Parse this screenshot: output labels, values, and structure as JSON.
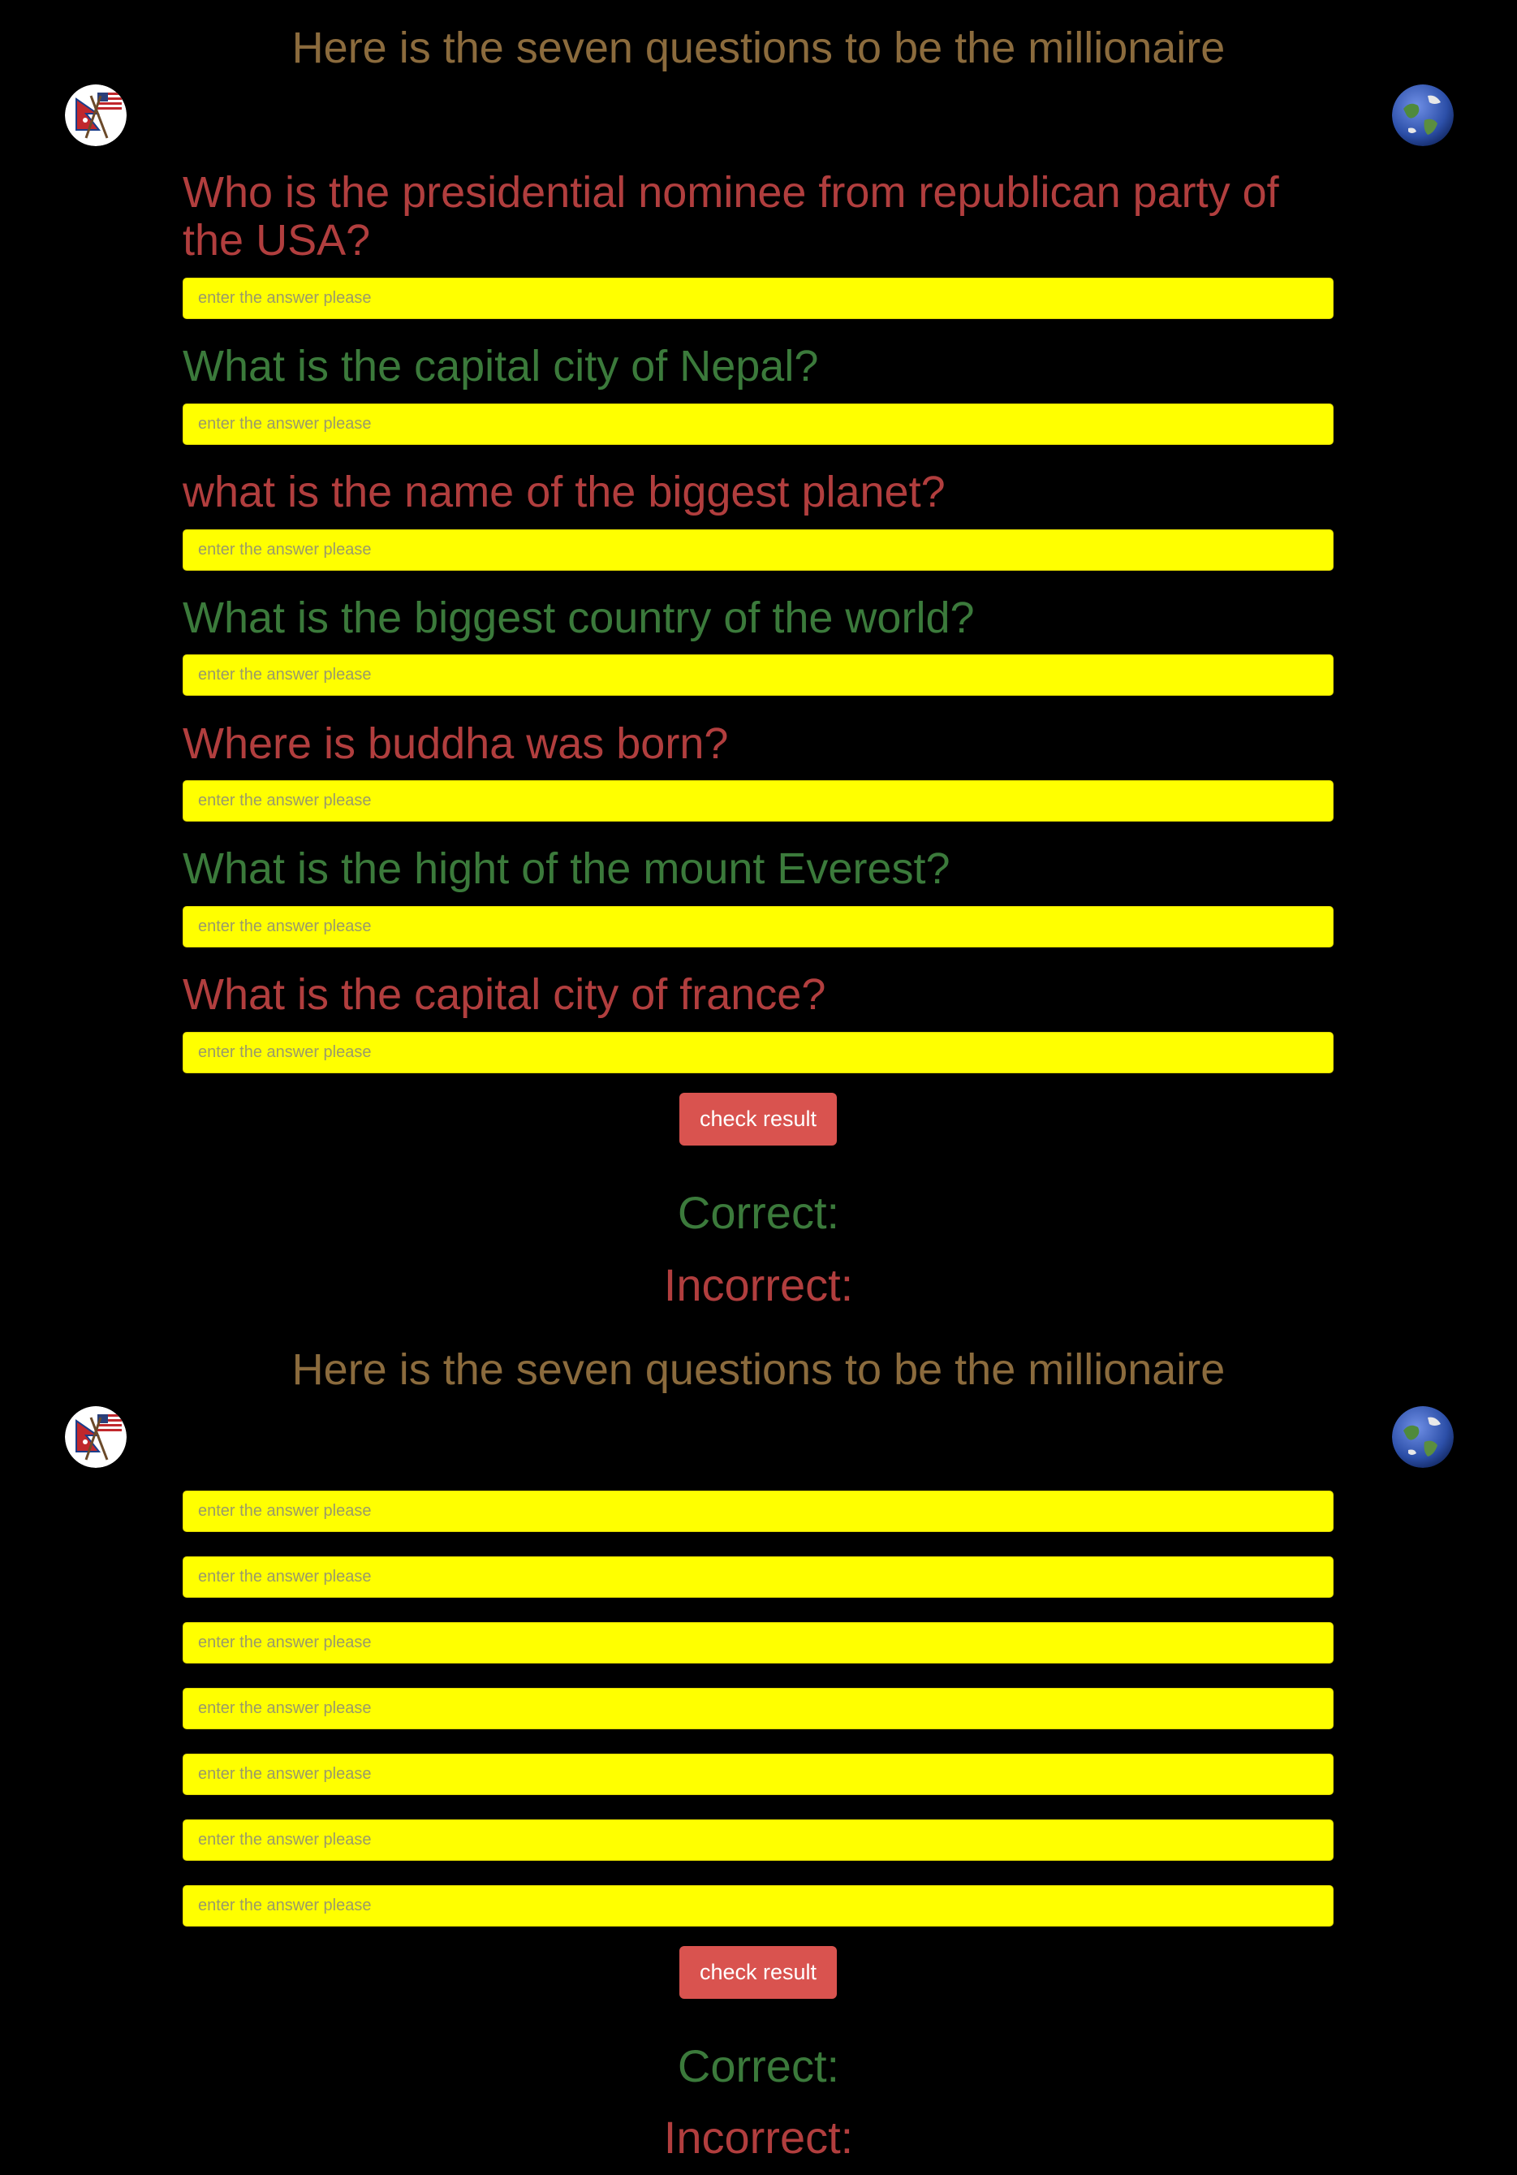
{
  "quiz_1": {
    "heading": "Here is the seven questions to be the millionaire",
    "questions": [
      {
        "text": "Who is the presidential nominee from republican party of the USA?",
        "placeholder": "enter the answer please"
      },
      {
        "text": "What is the capital city of Nepal?",
        "placeholder": "enter the answer please"
      },
      {
        "text": "what is the name of the biggest planet?",
        "placeholder": "enter the answer please"
      },
      {
        "text": "What is the biggest country of the world?",
        "placeholder": "enter the answer please"
      },
      {
        "text": "Where is buddha was born?",
        "placeholder": "enter the answer please"
      },
      {
        "text": "What is the hight of the mount Everest?",
        "placeholder": "enter the answer please"
      },
      {
        "text": "What is the capital city of france?",
        "placeholder": "enter the answer please"
      }
    ],
    "check_button": "check result",
    "correct_label": "Correct:",
    "incorrect_label": "Incorrect:"
  },
  "quiz_2": {
    "heading": "Here is the seven questions to be the millionaire",
    "answers": [
      {
        "placeholder": "enter the answer please"
      },
      {
        "placeholder": "enter the answer please"
      },
      {
        "placeholder": "enter the answer please"
      },
      {
        "placeholder": "enter the answer please"
      },
      {
        "placeholder": "enter the answer please"
      },
      {
        "placeholder": "enter the answer please"
      },
      {
        "placeholder": "enter the answer please"
      }
    ],
    "check_button": "check result",
    "correct_label": "Correct:",
    "incorrect_label": "Incorrect:"
  },
  "icons": {
    "left_logo": "nepal-usa-flags-icon",
    "right_logo": "earth-globe-icon"
  },
  "colors": {
    "background": "#000000",
    "heading": "#8b6b3d",
    "question_red": "#b13e3e",
    "question_green": "#3b7a3b",
    "input_background": "#ffff00",
    "button": "#d9534f"
  }
}
